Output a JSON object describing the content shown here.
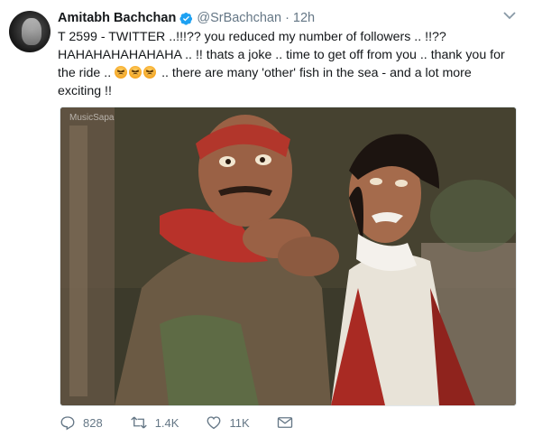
{
  "author": {
    "name": "Amitabh Bachchan",
    "handle": "@SrBachchan",
    "separator": "·",
    "time": "12h"
  },
  "icons": {
    "verified": "verified-badge-icon",
    "caret": "chevron-down-icon",
    "reply": "reply-icon",
    "retweet": "retweet-icon",
    "like": "heart-icon",
    "dm": "envelope-icon",
    "emoji": "angry-face-emoji"
  },
  "colors": {
    "accent": "#1da1f2",
    "meta": "#657786",
    "text": "#14171a"
  },
  "tweet": {
    "line1": "T 2599 - TWITTER ..!!!??  you reduced my number of followers .. !!??",
    "line2": "HAHAHAHAHAHAHA .. !! thats a joke .. time to get off from you .. thank you for",
    "line3_start": "the ride ..",
    "line3_end": ".. there are many 'other' fish in the sea - and a lot more",
    "line4": "exciting !!"
  },
  "media": {
    "watermark": "MusicSapa"
  },
  "actions": {
    "replies": "828",
    "retweets": "1.4K",
    "likes": "11K"
  }
}
